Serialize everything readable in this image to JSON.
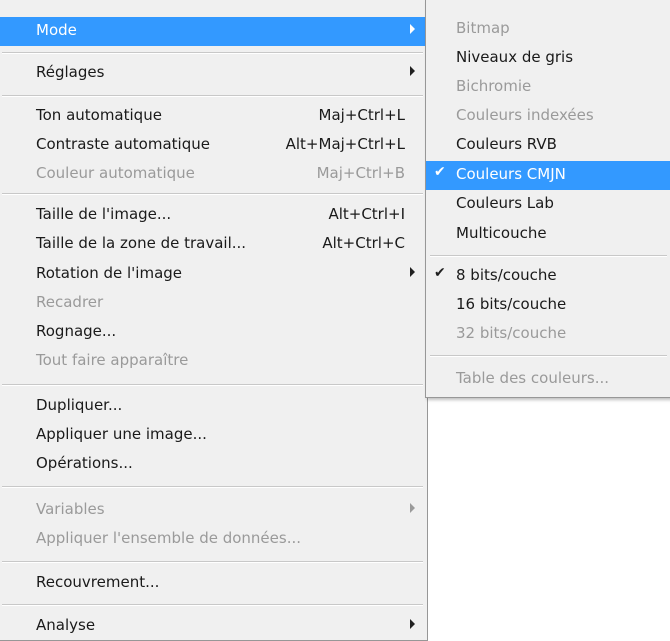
{
  "main_menu": {
    "items": [
      {
        "label": "Mode",
        "shortcut": "",
        "submenu": true,
        "state": "highlighted"
      },
      {
        "label": "Réglages",
        "shortcut": "",
        "submenu": true,
        "state": "enabled"
      },
      {
        "label": "Ton automatique",
        "shortcut": "Maj+Ctrl+L",
        "submenu": false,
        "state": "enabled"
      },
      {
        "label": "Contraste automatique",
        "shortcut": "Alt+Maj+Ctrl+L",
        "submenu": false,
        "state": "enabled"
      },
      {
        "label": "Couleur automatique",
        "shortcut": "Maj+Ctrl+B",
        "submenu": false,
        "state": "disabled"
      },
      {
        "label": "Taille de l'image...",
        "shortcut": "Alt+Ctrl+I",
        "submenu": false,
        "state": "enabled"
      },
      {
        "label": "Taille de la zone de travail...",
        "shortcut": "Alt+Ctrl+C",
        "submenu": false,
        "state": "enabled"
      },
      {
        "label": "Rotation de l'image",
        "shortcut": "",
        "submenu": true,
        "state": "enabled"
      },
      {
        "label": "Recadrer",
        "shortcut": "",
        "submenu": false,
        "state": "disabled"
      },
      {
        "label": "Rognage...",
        "shortcut": "",
        "submenu": false,
        "state": "enabled"
      },
      {
        "label": "Tout faire apparaître",
        "shortcut": "",
        "submenu": false,
        "state": "disabled"
      },
      {
        "label": "Dupliquer...",
        "shortcut": "",
        "submenu": false,
        "state": "enabled"
      },
      {
        "label": "Appliquer une image...",
        "shortcut": "",
        "submenu": false,
        "state": "enabled"
      },
      {
        "label": "Opérations...",
        "shortcut": "",
        "submenu": false,
        "state": "enabled"
      },
      {
        "label": "Variables",
        "shortcut": "",
        "submenu": true,
        "state": "disabled"
      },
      {
        "label": "Appliquer l'ensemble de données...",
        "shortcut": "",
        "submenu": false,
        "state": "disabled"
      },
      {
        "label": "Recouvrement...",
        "shortcut": "",
        "submenu": false,
        "state": "enabled"
      },
      {
        "label": "Analyse",
        "shortcut": "",
        "submenu": true,
        "state": "enabled"
      }
    ]
  },
  "mode_submenu": {
    "items": [
      {
        "label": "Bitmap",
        "checked": false,
        "state": "disabled"
      },
      {
        "label": "Niveaux de gris",
        "checked": false,
        "state": "enabled"
      },
      {
        "label": "Bichromie",
        "checked": false,
        "state": "disabled"
      },
      {
        "label": "Couleurs indexées",
        "checked": false,
        "state": "disabled"
      },
      {
        "label": "Couleurs RVB",
        "checked": false,
        "state": "enabled"
      },
      {
        "label": "Couleurs CMJN",
        "checked": true,
        "state": "highlighted"
      },
      {
        "label": "Couleurs Lab",
        "checked": false,
        "state": "enabled"
      },
      {
        "label": "Multicouche",
        "checked": false,
        "state": "enabled"
      },
      {
        "label": "8 bits/couche",
        "checked": true,
        "state": "enabled"
      },
      {
        "label": "16 bits/couche",
        "checked": false,
        "state": "enabled"
      },
      {
        "label": "32 bits/couche",
        "checked": false,
        "state": "disabled"
      },
      {
        "label": "Table des couleurs...",
        "checked": false,
        "state": "disabled"
      }
    ]
  },
  "check_glyph": "✔",
  "colors": {
    "highlight": "#3399ff",
    "menu_bg": "#f0f0f0",
    "disabled_text": "#9a9a9a"
  }
}
